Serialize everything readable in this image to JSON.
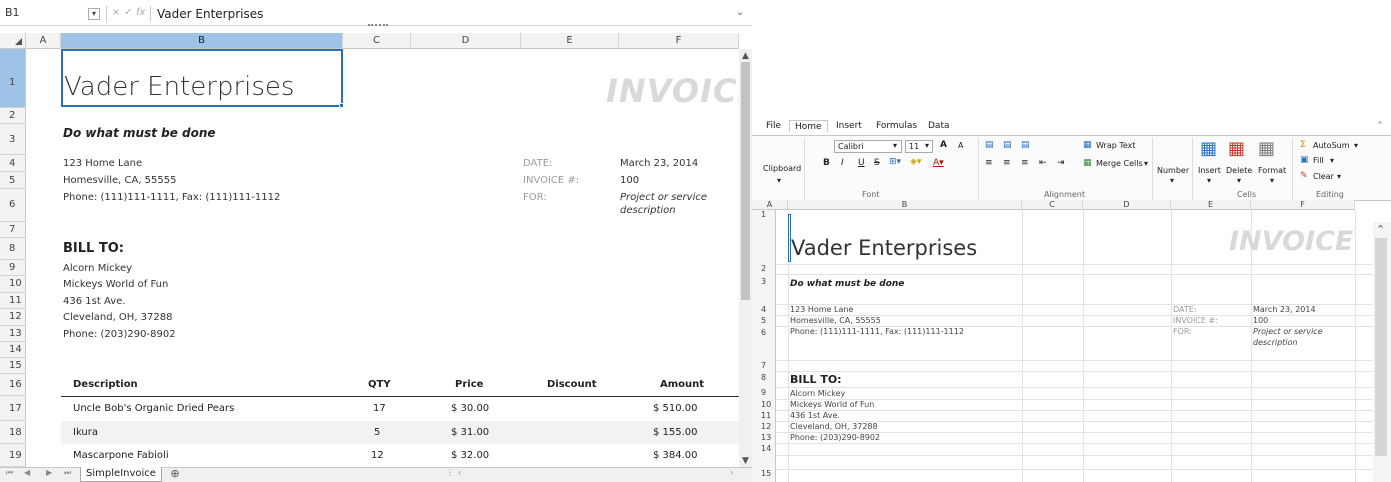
{
  "left": {
    "formula_bar": {
      "name_box": "B1",
      "dropdown_icon": "chevron-down-icon",
      "cancel_icon": "×",
      "enter_icon": "✓",
      "fx_icon": "fx",
      "formula_value": "Vader Enterprises"
    },
    "columns": [
      "A",
      "B",
      "C",
      "D",
      "E",
      "F"
    ],
    "rows": [
      "1",
      "2",
      "3",
      "4",
      "5",
      "6",
      "7",
      "8",
      "9",
      "10",
      "11",
      "12",
      "13",
      "14",
      "15",
      "16",
      "17",
      "18",
      "19"
    ],
    "company": "Vader Enterprises",
    "slogan": "Do what must be done",
    "invoice_title": "INVOICE",
    "address": [
      "123 Home Lane",
      "Homesville, CA, 55555",
      "Phone: (111)111-1111, Fax: (111)111-1112"
    ],
    "meta_labels": [
      "DATE:",
      "INVOICE #:",
      "FOR:"
    ],
    "meta_values": [
      "March 23, 2014",
      "100",
      "Project or service",
      "description"
    ],
    "bill_to_label": "BILL TO:",
    "bill_to": [
      "Alcorn Mickey",
      "Mickeys World of Fun",
      "436 1st Ave.",
      "Cleveland, OH, 37288",
      "Phone: (203)290-8902"
    ],
    "table": {
      "headers": [
        "Description",
        "QTY",
        "Price",
        "Discount",
        "Amount"
      ],
      "rows": [
        [
          "Uncle Bob's Organic Dried Pears",
          "17",
          "$ 30.00",
          "",
          "$ 510.00"
        ],
        [
          "Ikura",
          "5",
          "$ 31.00",
          "",
          "$ 155.00"
        ],
        [
          "Mascarpone Fabioli",
          "12",
          "$ 32.00",
          "",
          "$ 384.00"
        ]
      ]
    },
    "sheet_tab": "SimpleInvoice",
    "add_sheet_icon": "⊕"
  },
  "right": {
    "ribbon_tabs": [
      "File",
      "Home",
      "Insert",
      "Formulas",
      "Data"
    ],
    "active_tab": "Home",
    "clipboard_label": "Clipboard",
    "font": {
      "name": "Calibri",
      "size": "11",
      "bold": "B",
      "italic": "I",
      "underline": "U",
      "strike": "S",
      "grow": "A",
      "shrink": "A",
      "group_label": "Font"
    },
    "alignment": {
      "wrap_text": "Wrap Text",
      "merge_cells": "Merge Cells",
      "group_label": "Alignment"
    },
    "number_label": "Number",
    "cells": {
      "insert": "Insert",
      "delete": "Delete",
      "format": "Format",
      "group_label": "Cells"
    },
    "editing": {
      "autosum": "AutoSum",
      "fill": "Fill",
      "clear": "Clear",
      "group_label": "Editing"
    },
    "columns": [
      "A",
      "B",
      "C",
      "D",
      "E",
      "F"
    ],
    "rows": [
      "1",
      "2",
      "3",
      "4",
      "5",
      "6",
      "7",
      "8",
      "9",
      "10",
      "11",
      "12",
      "13",
      "14",
      "15"
    ]
  }
}
